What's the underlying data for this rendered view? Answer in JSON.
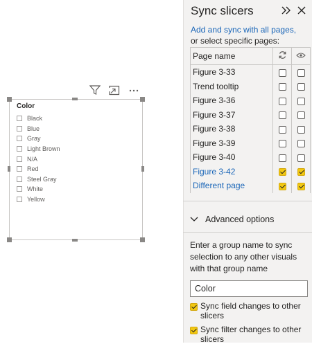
{
  "slicer": {
    "title": "Color",
    "items": [
      "Black",
      "Blue",
      "Gray",
      "Light Brown",
      "N/A",
      "Red",
      "Steel Gray",
      "White",
      "Yellow"
    ]
  },
  "visual_header_icons": [
    "filter-icon",
    "focus-mode-icon",
    "more-options-icon"
  ],
  "pane": {
    "title": "Sync slicers",
    "intro_link": "Add and sync with all pages,",
    "intro_text": "or select specific pages:",
    "table": {
      "header_name": "Page name",
      "header_sync_icon": "sync-icon",
      "header_visible_icon": "eye-icon",
      "rows": [
        {
          "name": "Figure 3-33",
          "sync": false,
          "visible": false,
          "highlight": false
        },
        {
          "name": "Trend tooltip",
          "sync": false,
          "visible": false,
          "highlight": false
        },
        {
          "name": "Figure 3-36",
          "sync": false,
          "visible": false,
          "highlight": false
        },
        {
          "name": "Figure 3-37",
          "sync": false,
          "visible": false,
          "highlight": false
        },
        {
          "name": "Figure 3-38",
          "sync": false,
          "visible": false,
          "highlight": false
        },
        {
          "name": "Figure 3-39",
          "sync": false,
          "visible": false,
          "highlight": false
        },
        {
          "name": "Figure 3-40",
          "sync": false,
          "visible": false,
          "highlight": false
        },
        {
          "name": "Figure 3-42",
          "sync": true,
          "visible": true,
          "highlight": true
        },
        {
          "name": "Different page",
          "sync": true,
          "visible": true,
          "highlight": true
        }
      ]
    },
    "advanced_label": "Advanced options",
    "group_description": "Enter a group name to sync selection to any other visuals with that group name",
    "group_value": "Color",
    "options": [
      {
        "label": "Sync field changes to other slicers",
        "checked": true
      },
      {
        "label": "Sync filter changes to other slicers",
        "checked": true
      }
    ],
    "accent_color": "#f2c811",
    "link_color": "#1a66b8"
  }
}
